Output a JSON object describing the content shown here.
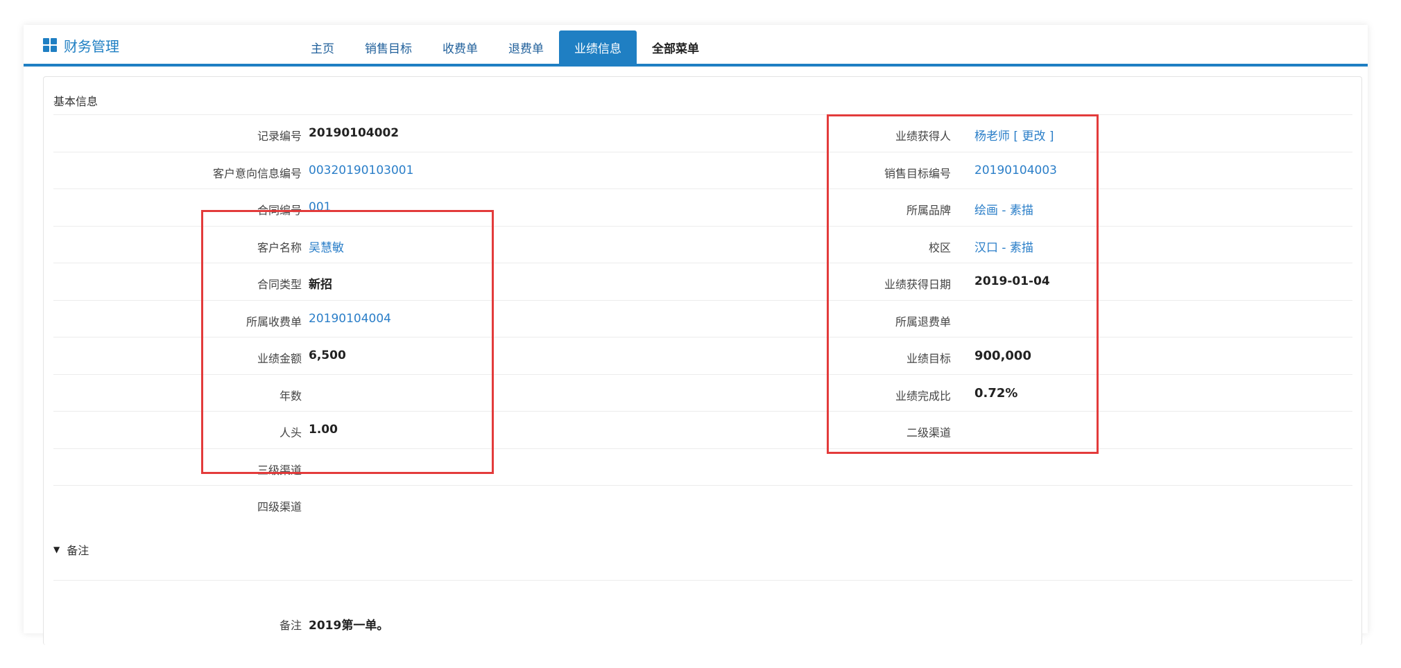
{
  "app": {
    "title": "财务管理",
    "icon": "grid-icon"
  },
  "nav": {
    "tabs": [
      {
        "label": "主页"
      },
      {
        "label": "销售目标"
      },
      {
        "label": "收费单"
      },
      {
        "label": "退费单"
      },
      {
        "label": "业绩信息"
      },
      {
        "label": "全部菜单"
      }
    ],
    "active_index": 4
  },
  "basic": {
    "title": "基本信息",
    "left": [
      {
        "label": "记录编号",
        "value": "20190104002",
        "style": "bold"
      },
      {
        "label": "客户意向信息编号",
        "value": "00320190103001",
        "style": "link"
      },
      {
        "label": "合同编号",
        "value": "001",
        "style": "link"
      },
      {
        "label": "客户名称",
        "value": "吴慧敏",
        "style": "link"
      },
      {
        "label": "合同类型",
        "value": "新招",
        "style": "bold"
      },
      {
        "label": "所属收费单",
        "value": "20190104004",
        "style": "link"
      },
      {
        "label": "业绩金额",
        "value": "6,500",
        "style": "bold"
      },
      {
        "label": "年数",
        "value": "",
        "style": "bold"
      },
      {
        "label": "人头",
        "value": "1.00",
        "style": "bold"
      },
      {
        "label": "三级渠道",
        "value": "",
        "style": "bold"
      },
      {
        "label": "四级渠道",
        "value": "",
        "style": "bold"
      }
    ],
    "right": [
      {
        "label": "业绩获得人",
        "value": "杨老师 [ 更改 ]",
        "style": "link"
      },
      {
        "label": "销售目标编号",
        "value": "20190104003",
        "style": "link"
      },
      {
        "label": "所属品牌",
        "value": "绘画 - 素描",
        "style": "link"
      },
      {
        "label": "校区",
        "value": "汉口 - 素描",
        "style": "link"
      },
      {
        "label": "业绩获得日期",
        "value": "2019-01-04",
        "style": "bold"
      },
      {
        "label": "所属退费单",
        "value": "",
        "style": "bold"
      },
      {
        "label": "业绩目标",
        "value": "900,000",
        "style": "bigbold"
      },
      {
        "label": "业绩完成比",
        "value": "0.72%",
        "style": "bigbold"
      },
      {
        "label": "二级渠道",
        "value": "",
        "style": "bold"
      }
    ]
  },
  "notes": {
    "title": "备注",
    "label": "备注",
    "value": "2019第一单。"
  },
  "colors": {
    "accent": "#1f7fc3",
    "link": "#2a7ec8",
    "highlight_box": "#e33b3b"
  }
}
